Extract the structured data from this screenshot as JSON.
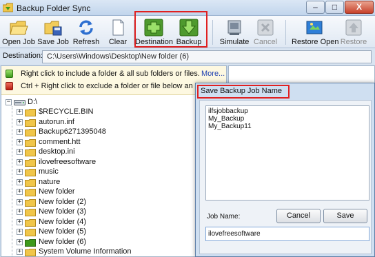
{
  "window": {
    "title": "Backup Folder Sync",
    "controls": {
      "minimize": "–",
      "maximize": "□",
      "close": "X"
    }
  },
  "toolbar": {
    "buttons": [
      {
        "label": "Open Job",
        "icon": "open-folder-icon",
        "enabled": true
      },
      {
        "label": "Save Job",
        "icon": "save-folder-icon",
        "enabled": true
      },
      {
        "label": "Refresh",
        "icon": "refresh-arrows-icon",
        "enabled": true
      },
      {
        "label": "Clear",
        "icon": "clear-page-icon",
        "enabled": true
      },
      {
        "label": "Destination",
        "icon": "plus-icon",
        "enabled": true
      },
      {
        "label": "Backup",
        "icon": "down-arrow-icon",
        "enabled": true
      },
      {
        "label": "Simulate",
        "icon": "simulate-icon",
        "enabled": true
      },
      {
        "label": "Cancel",
        "icon": "cancel-x-icon",
        "enabled": false
      },
      {
        "label": "Restore Open",
        "icon": "restore-open-icon",
        "enabled": true
      },
      {
        "label": "Restore",
        "icon": "restore-icon",
        "enabled": false
      }
    ]
  },
  "destination": {
    "label": "Destination:",
    "path": "C:\\Users\\Windows\\Desktop\\New folder (6)"
  },
  "info": {
    "include_text": "Right click to include a folder & all sub folders or files.",
    "exclude_text": "Ctrl + Right click to exclude a folder or file below an included fol",
    "more_link": "More..."
  },
  "tree": {
    "root": "D:\\",
    "items": [
      {
        "name": "$RECYCLE.BIN",
        "included": false
      },
      {
        "name": "autorun.inf",
        "included": false
      },
      {
        "name": "Backup6271395048",
        "included": false
      },
      {
        "name": "comment.htt",
        "included": false
      },
      {
        "name": "desktop.ini",
        "included": false
      },
      {
        "name": "ilovefreesoftware",
        "included": false
      },
      {
        "name": "music",
        "included": false
      },
      {
        "name": "nature",
        "included": false
      },
      {
        "name": "New folder",
        "included": false
      },
      {
        "name": "New folder (2)",
        "included": false
      },
      {
        "name": "New folder (3)",
        "included": false
      },
      {
        "name": "New folder (4)",
        "included": false
      },
      {
        "name": "New folder (5)",
        "included": false
      },
      {
        "name": "New folder (6)",
        "included": true
      },
      {
        "name": "System Volume Information",
        "included": false
      }
    ]
  },
  "dialog": {
    "title": "Save Backup Job Name",
    "jobs": [
      "ilfsjobbackup",
      "My_Backup",
      "My_Backup11"
    ],
    "job_name_label": "Job Name:",
    "job_name_value": "ilovefreesoftware",
    "cancel_label": "Cancel",
    "save_label": "Save"
  },
  "colors": {
    "highlight": "#e02020",
    "include": "#3e9a1c",
    "exclude": "#b71f12",
    "folder": "#f0c64a"
  }
}
